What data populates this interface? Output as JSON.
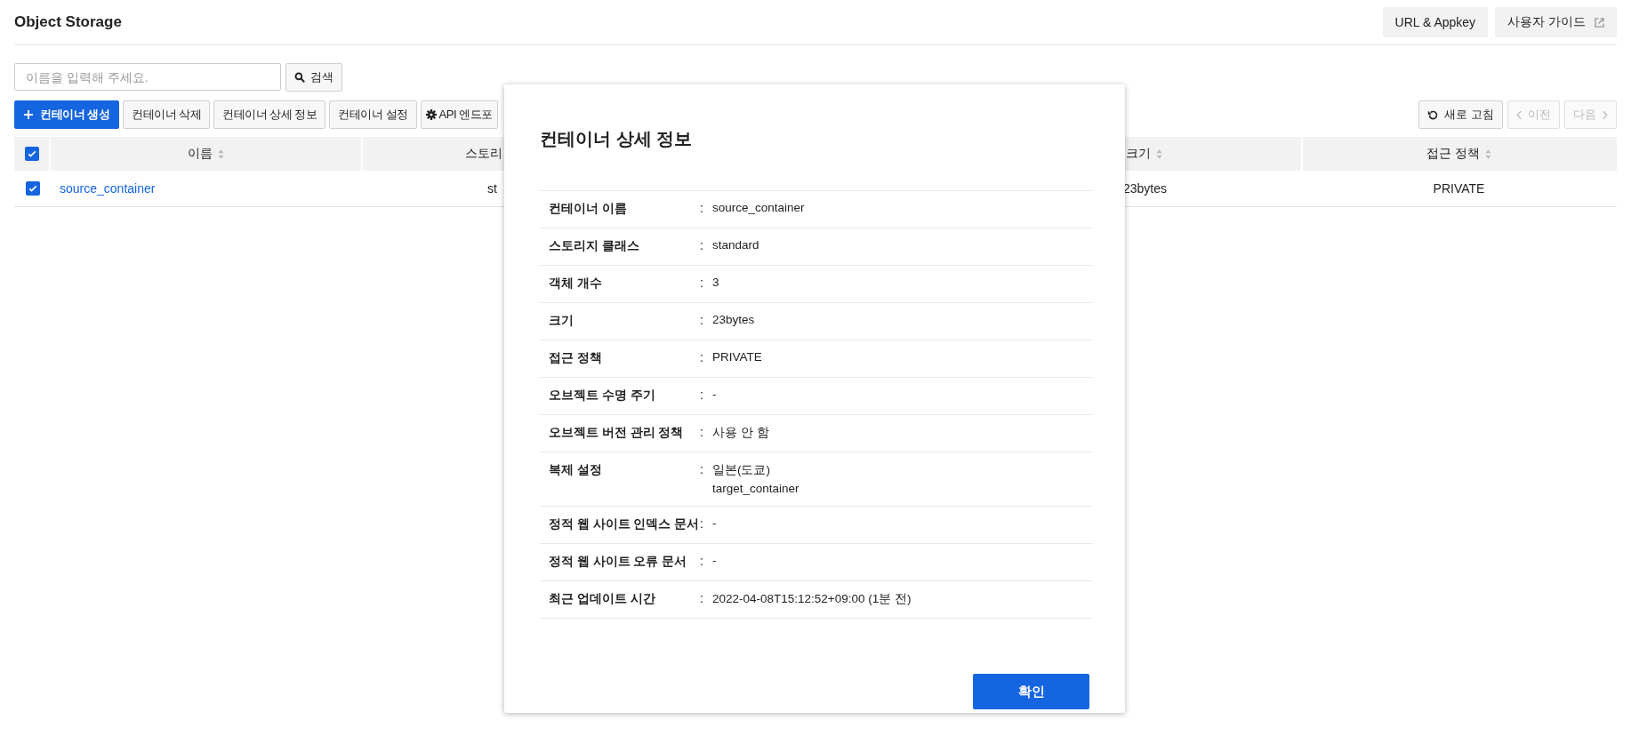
{
  "header": {
    "title": "Object Storage",
    "buttons": [
      {
        "label": "URL & Appkey",
        "kind": "plain"
      },
      {
        "label": "사용자 가이드",
        "kind": "external"
      }
    ]
  },
  "search": {
    "placeholder": "이름을 입력해 주세요.",
    "button": "검색"
  },
  "toolbar": {
    "buttons": [
      {
        "label": "컨테이너 생성",
        "kind": "primary"
      },
      {
        "label": "컨테이너 삭제",
        "kind": "default"
      },
      {
        "label": "컨테이너 상세 정보",
        "kind": "default"
      },
      {
        "label": "컨테이너 설정",
        "kind": "default"
      },
      {
        "label": "API 엔드포",
        "kind": "settings"
      }
    ],
    "right_buttons": [
      {
        "label": "새로 고침",
        "kind": "refresh",
        "disabled": false
      },
      {
        "label": "이전",
        "kind": "prev",
        "disabled": true
      },
      {
        "label": "다음",
        "kind": "next",
        "disabled": true
      }
    ]
  },
  "table": {
    "select_all_checked": true,
    "columns": [
      {
        "label": "이름",
        "kind": "name",
        "sortable": true
      },
      {
        "label": "스토리",
        "kind": "storage",
        "sortable": false
      },
      {
        "label": "크기",
        "kind": "size",
        "sortable": true
      },
      {
        "label": "접근 정책",
        "kind": "access",
        "sortable": true
      }
    ],
    "rows": [
      {
        "checked": true,
        "cells": [
          "source_container",
          "st",
          "23bytes",
          "PRIVATE"
        ]
      }
    ]
  },
  "modal": {
    "title": "컨테이너 상세 정보",
    "separator": ":",
    "rows": [
      {
        "label": "컨테이너 이름",
        "values": [
          "source_container"
        ]
      },
      {
        "label": "스토리지 클래스",
        "values": [
          "standard"
        ]
      },
      {
        "label": "객체 개수",
        "values": [
          "3"
        ]
      },
      {
        "label": "크기",
        "values": [
          "23bytes"
        ]
      },
      {
        "label": "접근 정책",
        "values": [
          "PRIVATE"
        ]
      },
      {
        "label": "오브젝트 수명 주기",
        "values": [
          "-"
        ]
      },
      {
        "label": "오브젝트 버전 관리 정책",
        "values": [
          "사용 안 함"
        ]
      },
      {
        "label": "복제 설정",
        "values": [
          "일본(도쿄)",
          "target_container"
        ]
      },
      {
        "label": "정적 웹 사이트 인덱스 문서",
        "values": [
          "-"
        ]
      },
      {
        "label": "정적 웹 사이트 오류 문서",
        "values": [
          "-"
        ]
      },
      {
        "label": "최근 업데이트 시간",
        "values": [
          "2022-04-08T15:12:52+09:00 (1분 전)"
        ]
      }
    ],
    "confirm": "확인"
  }
}
